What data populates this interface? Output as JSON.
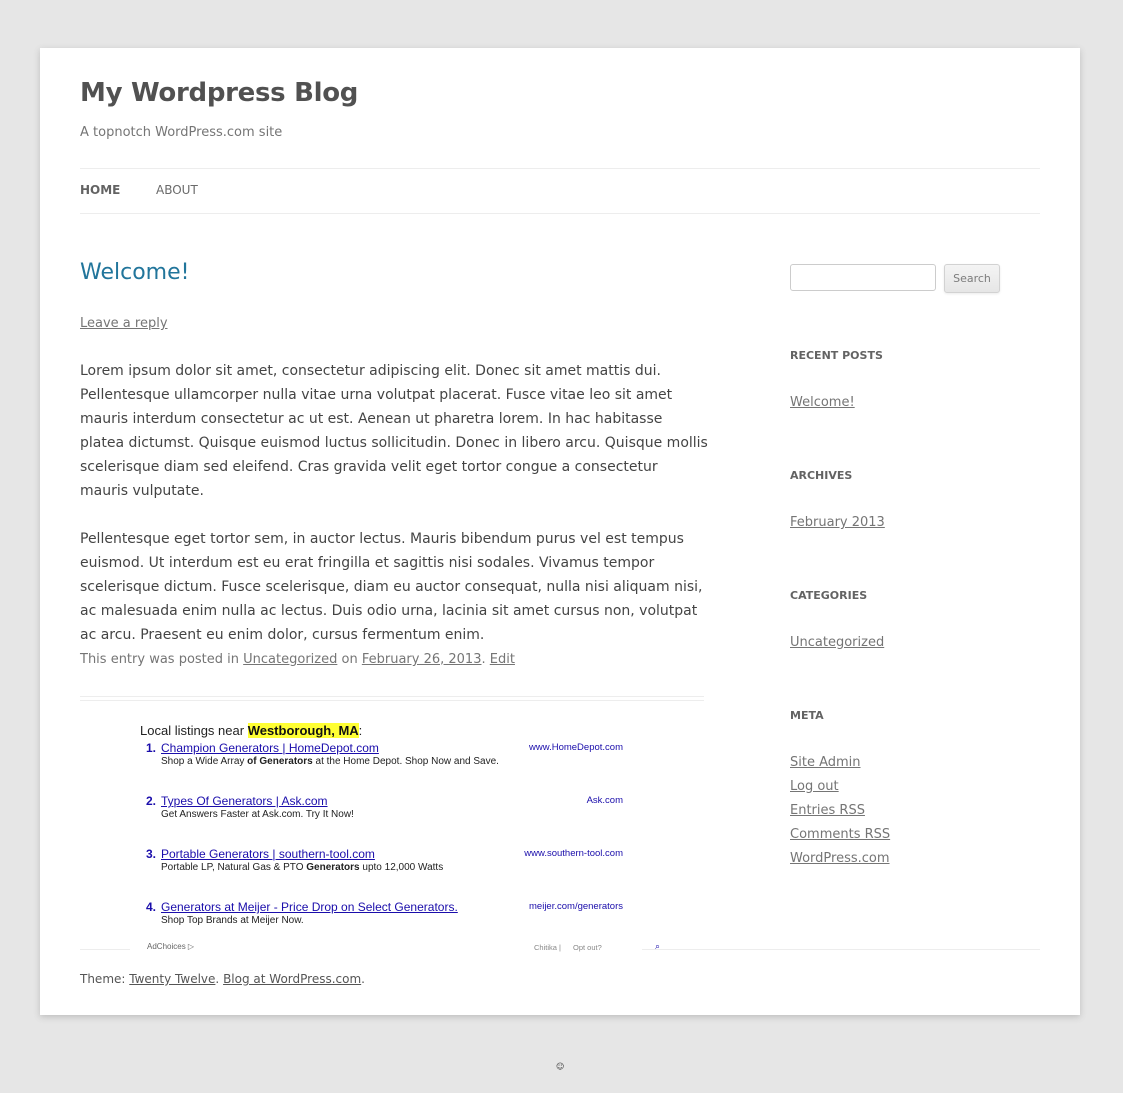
{
  "site": {
    "title": "My Wordpress Blog",
    "description": "A topnotch WordPress.com site"
  },
  "nav": {
    "home": "HOME",
    "about": "ABOUT"
  },
  "post": {
    "title": "Welcome!",
    "leave_reply": "Leave a reply",
    "paragraphs": [
      "Lorem ipsum dolor sit amet, consectetur adipiscing elit. Donec sit amet mattis dui. Pellentesque ullamcorper nulla vitae urna volutpat placerat. Fusce vitae leo sit amet mauris interdum consectetur ac ut est. Aenean ut pharetra lorem. In hac habitasse platea dictumst. Quisque euismod luctus sollicitudin. Donec in libero arcu. Quisque mollis scelerisque diam sed eleifend. Cras gravida velit eget tortor congue a consectetur mauris vulputate.",
      "Pellentesque eget tortor sem, in auctor lectus. Mauris bibendum purus vel est tempus euismod. Ut interdum est eu erat fringilla et sagittis nisi sodales. Vivamus tempor scelerisque dictum. Fusce scelerisque, diam eu auctor consequat, nulla nisi aliquam nisi, ac malesuada enim nulla ac lectus. Duis odio urna, lacinia sit amet cursus non, volutpat ac arcu. Praesent eu enim dolor, cursus fermentum enim."
    ],
    "meta": {
      "prefix": "This entry was posted in",
      "category": "Uncategorized",
      "on": "on",
      "date": "February 26, 2013",
      "period": ".",
      "edit": "Edit"
    }
  },
  "ads": {
    "heading_prefix": "Local listings near",
    "location": "Westborough, MA",
    "heading_suffix": ":",
    "items": [
      {
        "num": "1.",
        "title": "Champion Generators | HomeDepot.com",
        "desc": "Shop a Wide Array of Generators at the Home Depot. Shop Now and Save.",
        "url": "www.HomeDepot.com"
      },
      {
        "num": "2.",
        "title": "Types Of Generators | Ask.com",
        "desc": "Get Answers Faster at Ask.com. Try It Now!",
        "url": "Ask.com"
      },
      {
        "num": "3.",
        "title": "Portable Generators | southern-tool.com",
        "desc": "Portable LP, Natural Gas & PTO Generators upto 12,000 Watts",
        "url": "www.southern-tool.com"
      },
      {
        "num": "4.",
        "title": "Generators at Meijer - Price Drop on Select Generators.",
        "desc": "Shop Top Brands at Meijer Now.",
        "url": "meijer.com/generators"
      }
    ],
    "adchoices": "AdChoices ▷",
    "chitika": "Chitika |",
    "optout": "Opt out?",
    "magnifier_icon": "search-icon"
  },
  "sidebar": {
    "search_input_value": "",
    "search_button": "Search",
    "recent_posts_title": "RECENT POSTS",
    "recent_posts": [
      "Welcome!"
    ],
    "archives_title": "ARCHIVES",
    "archives": [
      "February 2013"
    ],
    "categories_title": "CATEGORIES",
    "categories": [
      "Uncategorized"
    ],
    "meta_title": "META",
    "meta_links": [
      "Site Admin",
      "Log out",
      "Entries RSS",
      "Comments RSS",
      "WordPress.com"
    ]
  },
  "footer": {
    "theme_prefix": "Theme:",
    "theme_link": "Twenty Twelve",
    "sep": ".",
    "blog_link": "Blog at WordPress.com",
    "end": "."
  }
}
